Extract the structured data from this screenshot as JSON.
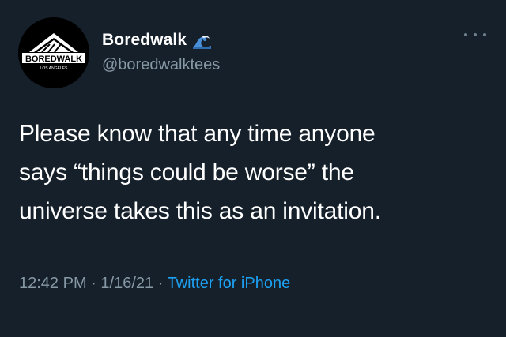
{
  "author": {
    "display_name": "Boredwalk",
    "handle": "@boredwalktees",
    "name_emoji_icon": "water-wave-icon",
    "avatar_logo_text": "BOREDWALK",
    "avatar_logo_subtext": "LOS ANGELES"
  },
  "tweet": {
    "text_lines": [
      "Please know that any time anyone",
      "says “things could be worse” the",
      "universe takes this as an invitation."
    ]
  },
  "meta": {
    "time": "12:42 PM",
    "date": "1/16/21",
    "separator": "·",
    "source": "Twitter for iPhone"
  },
  "menu": {
    "icon": "more-options-icon"
  },
  "colors": {
    "background": "#15202b",
    "text_primary": "#ffffff",
    "text_secondary": "#8899a6",
    "link": "#1da1f2"
  }
}
